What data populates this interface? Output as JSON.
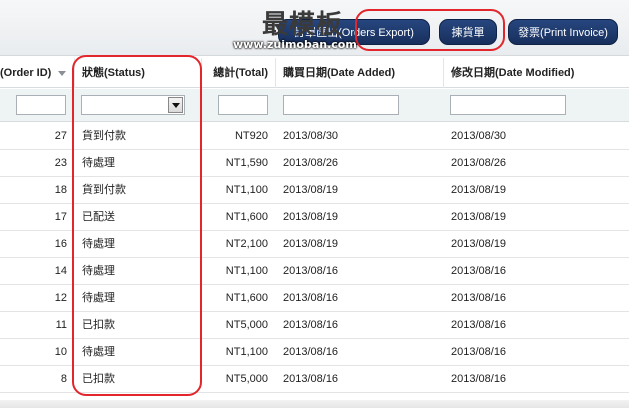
{
  "toolbar": {
    "export_label": "訂單匯出(Orders Export)",
    "picking_label": "揀貨單",
    "invoice_label": "發票(Print Invoice)"
  },
  "watermark": {
    "logo_text": "最模板",
    "url": "www.zuimoban.com"
  },
  "table": {
    "headers": {
      "order_id": "(Order ID)",
      "status": "狀態(Status)",
      "total": "總計(Total)",
      "date_added": "購買日期(Date Added)",
      "date_modified": "修改日期(Date Modified)"
    },
    "rows": [
      {
        "id": "27",
        "status": "貨到付款",
        "total": "NT920",
        "added": "2013/08/30",
        "modified": "2013/08/30"
      },
      {
        "id": "23",
        "status": "待處理",
        "total": "NT1,590",
        "added": "2013/08/26",
        "modified": "2013/08/26"
      },
      {
        "id": "18",
        "status": "貨到付款",
        "total": "NT1,100",
        "added": "2013/08/19",
        "modified": "2013/08/19"
      },
      {
        "id": "17",
        "status": "已配送",
        "total": "NT1,600",
        "added": "2013/08/19",
        "modified": "2013/08/19"
      },
      {
        "id": "16",
        "status": "待處理",
        "total": "NT2,100",
        "added": "2013/08/19",
        "modified": "2013/08/19"
      },
      {
        "id": "14",
        "status": "待處理",
        "total": "NT1,100",
        "added": "2013/08/16",
        "modified": "2013/08/16"
      },
      {
        "id": "12",
        "status": "待處理",
        "total": "NT1,600",
        "added": "2013/08/16",
        "modified": "2013/08/16"
      },
      {
        "id": "11",
        "status": "已扣款",
        "total": "NT5,000",
        "added": "2013/08/16",
        "modified": "2013/08/16"
      },
      {
        "id": "10",
        "status": "待處理",
        "total": "NT1,100",
        "added": "2013/08/16",
        "modified": "2013/08/16"
      },
      {
        "id": "8",
        "status": "已扣款",
        "total": "NT5,000",
        "added": "2013/08/16",
        "modified": "2013/08/16"
      }
    ]
  },
  "colors": {
    "button_bg": "#1f3b6e",
    "highlight": "#e2262b",
    "filter_bg": "#eef3f3"
  }
}
